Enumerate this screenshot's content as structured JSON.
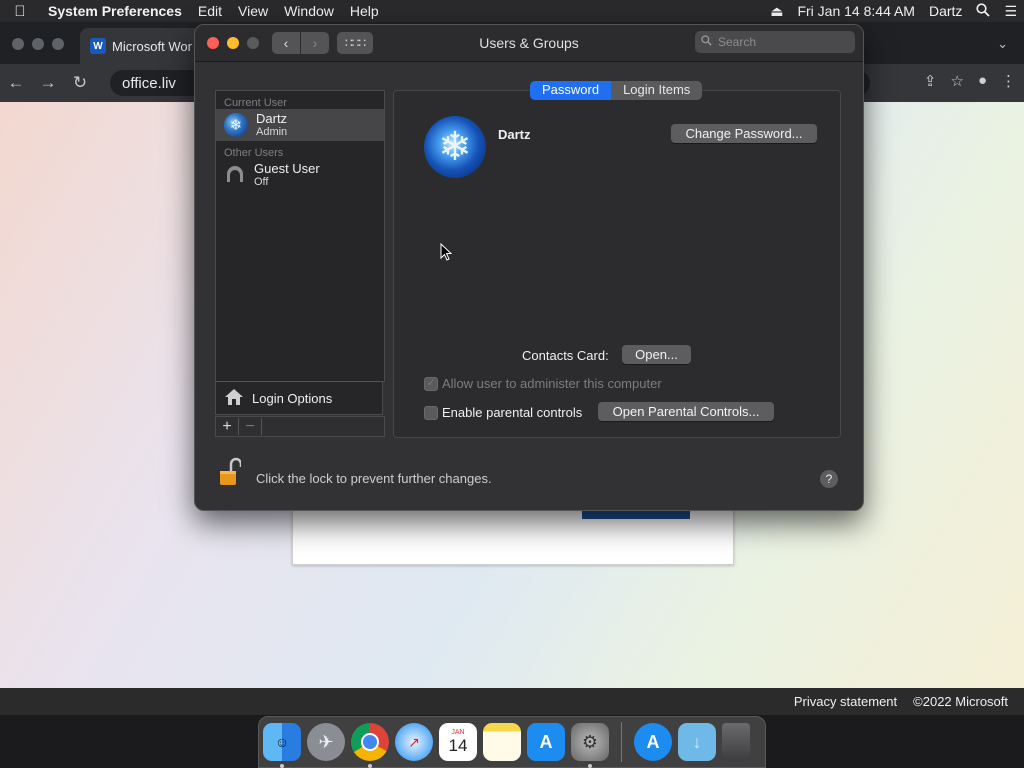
{
  "menubar": {
    "apple_icon": "apple-logo-icon",
    "items": [
      "System Preferences",
      "Edit",
      "View",
      "Window",
      "Help"
    ],
    "clock": "Fri Jan 14  8:44 AM",
    "user": "Dartz"
  },
  "browser": {
    "tab_title": "Microsoft Wor",
    "tab_icon_letter": "W",
    "address": "office.liv"
  },
  "page": {
    "footer_privacy": "Privacy statement",
    "footer_copyright": "©2022 Microsoft"
  },
  "window": {
    "title": "Users & Groups",
    "search_placeholder": "Search",
    "sections": {
      "current": "Current User",
      "other": "Other Users"
    },
    "users": [
      {
        "name": "Dartz",
        "role": "Admin",
        "selected": true
      },
      {
        "name": "Guest User",
        "role": "Off",
        "selected": false
      }
    ],
    "login_options": "Login Options",
    "tabs": [
      {
        "label": "Password",
        "active": true
      },
      {
        "label": "Login Items",
        "active": false
      }
    ],
    "selected_user_name": "Dartz",
    "change_password": "Change Password...",
    "contacts_card_label": "Contacts Card:",
    "open_button": "Open...",
    "allow_admin_label": "Allow user to administer this computer",
    "allow_admin_checked": true,
    "parental_label": "Enable parental controls",
    "parental_checked": false,
    "open_parental": "Open Parental Controls...",
    "lock_message": "Click the lock to prevent further changes.",
    "help": "?"
  },
  "dock": {
    "calendar_month": "JAN",
    "calendar_day": "14"
  },
  "colors": {
    "accent": "#1f6ff0",
    "close": "#ff5f57",
    "minimize": "#febc2e"
  }
}
